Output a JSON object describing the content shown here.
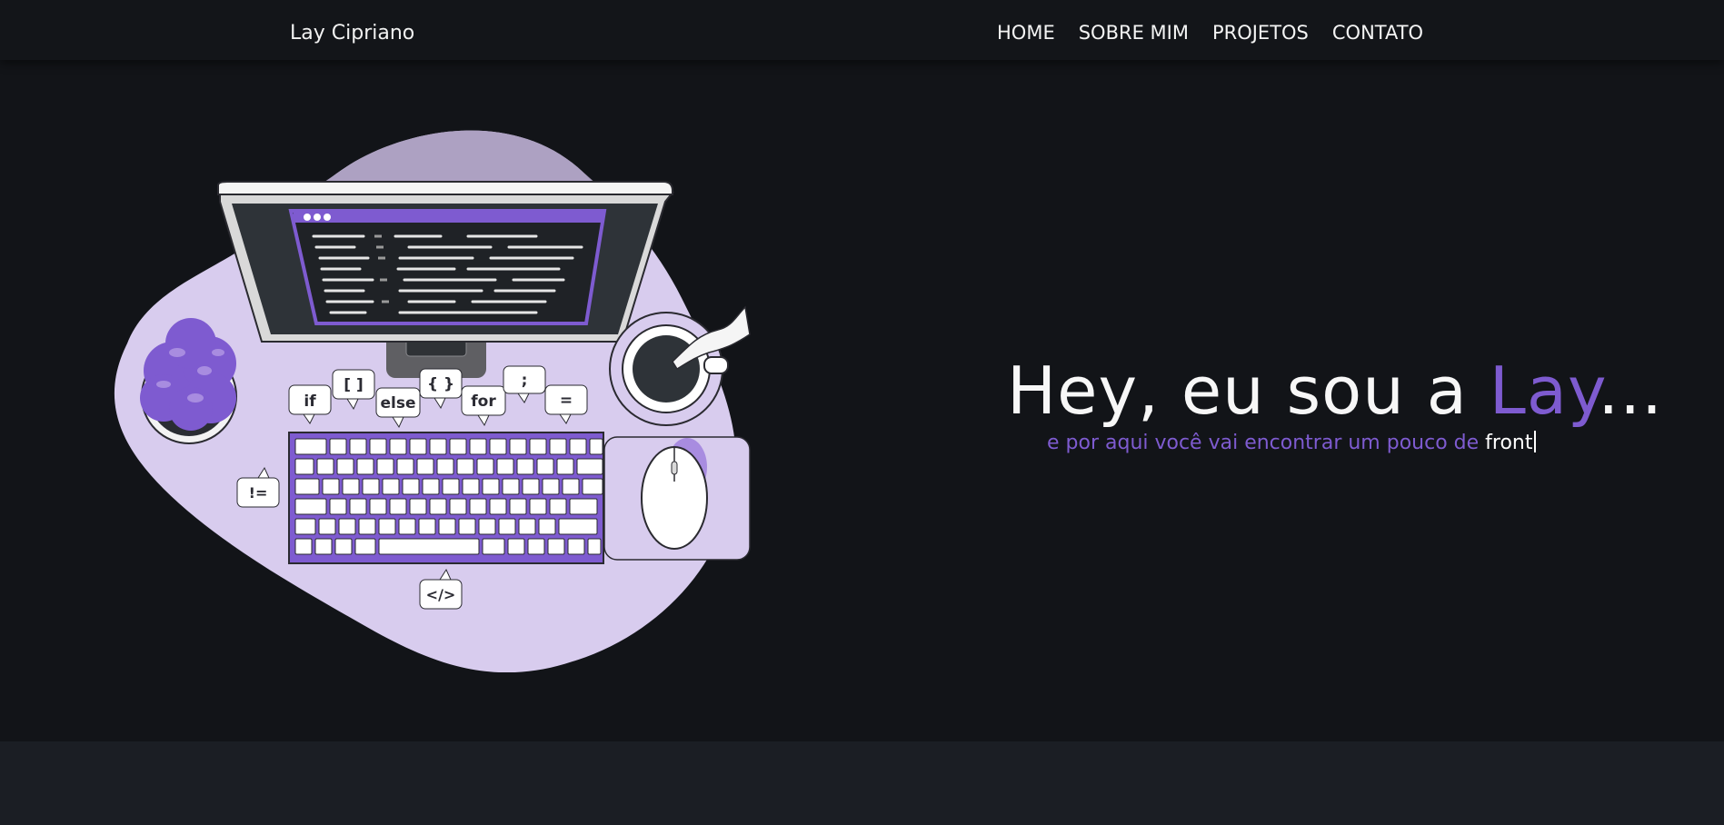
{
  "nav": {
    "brand": "Lay Cipriano",
    "items": [
      {
        "label": "HOME"
      },
      {
        "label": "SOBRE MIM"
      },
      {
        "label": "PROJETOS"
      },
      {
        "label": "CONTATO"
      }
    ]
  },
  "hero": {
    "greeting": "Hey, eu sou a ",
    "name": "Lay",
    "ellipsis": "...",
    "subtitle": "e por aqui você vai encontrar um pouco de ",
    "typed_word": "front"
  },
  "illustration": {
    "bubbles": [
      "if",
      "[ ]",
      "else",
      "{ }",
      "for",
      ";",
      "=",
      "!=",
      "</>"
    ]
  },
  "colors": {
    "background": "#121418",
    "accent": "#7e5bd0",
    "blob": "#d8ccee",
    "footer": "#1b1e24"
  }
}
